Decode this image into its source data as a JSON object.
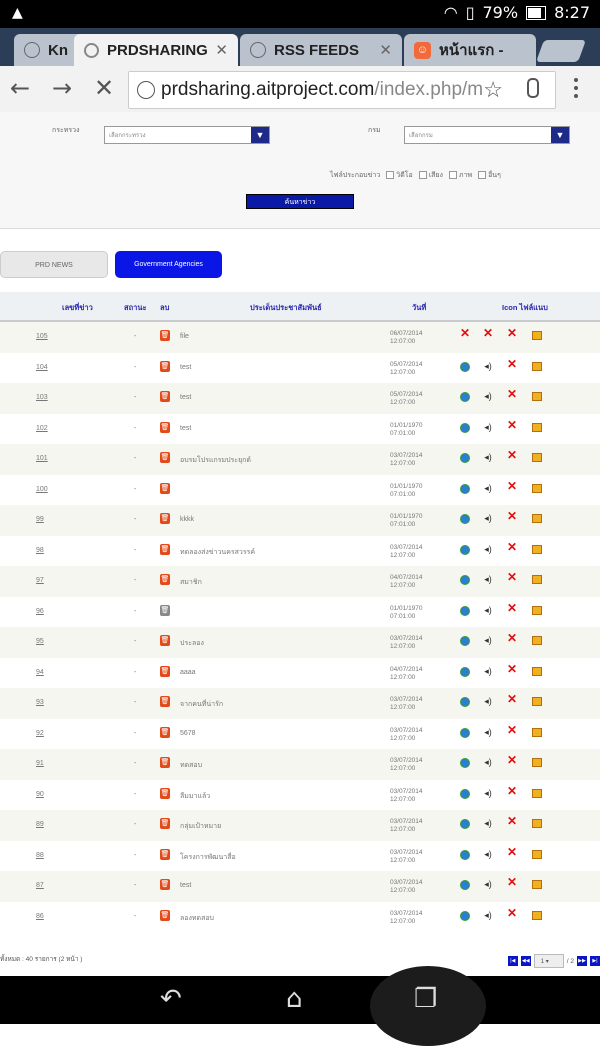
{
  "status_bar": {
    "battery": "79%",
    "time": "8:27"
  },
  "tabs": [
    {
      "label": "Kn",
      "icon": "globe-icon",
      "active": false
    },
    {
      "label": "PRDSHARING",
      "icon": "loading-icon",
      "active": true
    },
    {
      "label": "RSS FEEDS",
      "icon": "globe-icon",
      "active": false
    },
    {
      "label": "หน้าแรก -",
      "icon": "site-favicon-icon",
      "active": false
    }
  ],
  "omnibox": {
    "domain": "prdsharing.aitproject.com",
    "path": "/index.php/m"
  },
  "search_form": {
    "ministry_label": "กระทรวง",
    "ministry_value": "เลือกกระทรวง",
    "department_label": "กรม",
    "department_value": "เลือกกรม",
    "attachment_label": "ไฟล์ประกอบข่าว",
    "options": [
      "วิดีโอ",
      "เสียง",
      "ภาพ",
      "อื่นๆ"
    ],
    "search_button": "ค้นหาข่าว"
  },
  "source_tabs": {
    "prd": "PRD NEWS",
    "gov": "Government Agencies"
  },
  "table": {
    "headers": {
      "id": "เลขที่ข่าว",
      "status": "สถานะ",
      "delete": "ลบ",
      "topic": "ประเด็นประชาสัมพันธ์",
      "date": "วันที่",
      "attach": "Icon ไฟล์แนบ"
    },
    "rows": [
      {
        "id": "105",
        "status": "-",
        "title": "file",
        "date": "06/07/2014",
        "time": "12:07:00",
        "icons": [
          "x",
          "x",
          "x",
          "mail"
        ],
        "del": "red"
      },
      {
        "id": "104",
        "status": "-",
        "title": "test",
        "date": "05/07/2014",
        "time": "12:07:00",
        "icons": [
          "globe",
          "sound",
          "x",
          "mail"
        ],
        "del": "red"
      },
      {
        "id": "103",
        "status": "-",
        "title": "test",
        "date": "05/07/2014",
        "time": "12:07:00",
        "icons": [
          "globe",
          "sound",
          "x",
          "mail"
        ],
        "del": "red"
      },
      {
        "id": "102",
        "status": "-",
        "title": "test",
        "date": "01/01/1970",
        "time": "07:01:00",
        "icons": [
          "globe",
          "sound",
          "x",
          "mail"
        ],
        "del": "red"
      },
      {
        "id": "101",
        "status": "-",
        "title": "อบรมโปรแกรมประยุกต์",
        "date": "03/07/2014",
        "time": "12:07:00",
        "icons": [
          "globe",
          "sound",
          "x",
          "mail"
        ],
        "del": "red"
      },
      {
        "id": "100",
        "status": "-",
        "title": "",
        "date": "01/01/1970",
        "time": "07:01:00",
        "icons": [
          "globe",
          "sound",
          "x",
          "mail"
        ],
        "del": "red"
      },
      {
        "id": "99",
        "status": "-",
        "title": "kkkk",
        "date": "01/01/1970",
        "time": "07:01:00",
        "icons": [
          "globe",
          "sound",
          "x",
          "mail"
        ],
        "del": "red"
      },
      {
        "id": "98",
        "status": "-",
        "title": "ทดลองส่งข่าวนครสวรรค์",
        "date": "03/07/2014",
        "time": "12:07:00",
        "icons": [
          "globe",
          "sound",
          "x",
          "mail"
        ],
        "del": "red"
      },
      {
        "id": "97",
        "status": "-",
        "title": "สมาชิก",
        "date": "04/07/2014",
        "time": "12:07:00",
        "icons": [
          "globe",
          "sound",
          "x",
          "mail"
        ],
        "del": "red"
      },
      {
        "id": "96",
        "status": "-",
        "title": "",
        "date": "01/01/1970",
        "time": "07:01:00",
        "icons": [
          "globe",
          "sound",
          "x",
          "mail"
        ],
        "del": "gray"
      },
      {
        "id": "95",
        "status": "-",
        "title": "ประลอง",
        "date": "03/07/2014",
        "time": "12:07:00",
        "icons": [
          "globe",
          "sound",
          "x",
          "mail"
        ],
        "del": "red"
      },
      {
        "id": "94",
        "status": "-",
        "title": "aaaa",
        "date": "04/07/2014",
        "time": "12:07:00",
        "icons": [
          "globe",
          "sound",
          "x",
          "mail"
        ],
        "del": "red"
      },
      {
        "id": "93",
        "status": "-",
        "title": "จากคนที่น่ารัก",
        "date": "03/07/2014",
        "time": "12:07:00",
        "icons": [
          "globe",
          "sound",
          "x",
          "mail"
        ],
        "del": "red"
      },
      {
        "id": "92",
        "status": "-",
        "title": "5678",
        "date": "03/07/2014",
        "time": "12:07:00",
        "icons": [
          "globe",
          "sound",
          "x",
          "mail"
        ],
        "del": "red"
      },
      {
        "id": "91",
        "status": "-",
        "title": "ทดสอบ",
        "date": "03/07/2014",
        "time": "12:07:00",
        "icons": [
          "globe",
          "sound",
          "x",
          "mail"
        ],
        "del": "red"
      },
      {
        "id": "90",
        "status": "-",
        "title": "ลืมมาแล้ว",
        "date": "03/07/2014",
        "time": "12:07:00",
        "icons": [
          "globe",
          "sound",
          "x",
          "mail"
        ],
        "del": "red"
      },
      {
        "id": "89",
        "status": "-",
        "title": "กลุ่มเป้าหมาย",
        "date": "03/07/2014",
        "time": "12:07:00",
        "icons": [
          "globe",
          "sound",
          "x",
          "mail"
        ],
        "del": "red"
      },
      {
        "id": "88",
        "status": "-",
        "title": "โครงการพัฒนาสื่อ",
        "date": "03/07/2014",
        "time": "12:07:00",
        "icons": [
          "globe",
          "sound",
          "x",
          "mail"
        ],
        "del": "red"
      },
      {
        "id": "87",
        "status": "-",
        "title": "test",
        "date": "03/07/2014",
        "time": "12:07:00",
        "icons": [
          "globe",
          "sound",
          "x",
          "mail"
        ],
        "del": "red"
      },
      {
        "id": "86",
        "status": "-",
        "title": "ลองทดสอบ",
        "date": "03/07/2014",
        "time": "12:07:00",
        "icons": [
          "globe",
          "sound",
          "x",
          "mail"
        ],
        "del": "red"
      }
    ]
  },
  "footer": {
    "total": "ทั้งหมด : 40 รายการ (2 หน้า )",
    "page_value": "1",
    "page_total": "/ 2"
  }
}
